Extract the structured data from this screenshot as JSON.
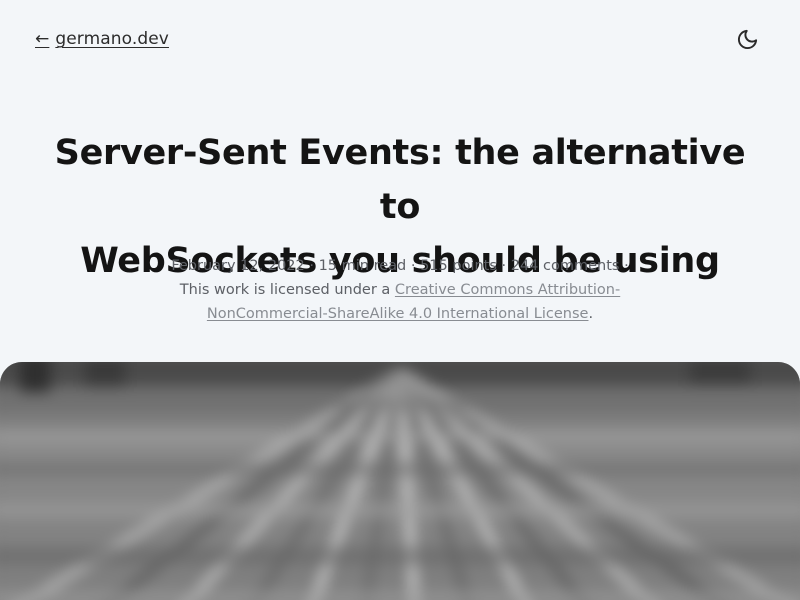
{
  "header": {
    "back_arrow": "←",
    "back_label": "germano.dev",
    "theme_icon": "moon-icon"
  },
  "article": {
    "title_line1": "Server-Sent Events: the alternative to",
    "title_line2": "WebSockets you should be using",
    "date": "February 12, 2022",
    "read_time": "15 min read",
    "points": "515 points",
    "comments": "244 comments",
    "separator": " · ",
    "license_prefix": "This work is licensed under a ",
    "license_link_line1": "Creative Commons Attribution-",
    "license_link_line2": "NonCommercial-ShareAlike 4.0 International License",
    "license_suffix": "."
  },
  "hero": {
    "image_name": "blurred-server-rack-image",
    "tone": "#7a7a7a"
  }
}
